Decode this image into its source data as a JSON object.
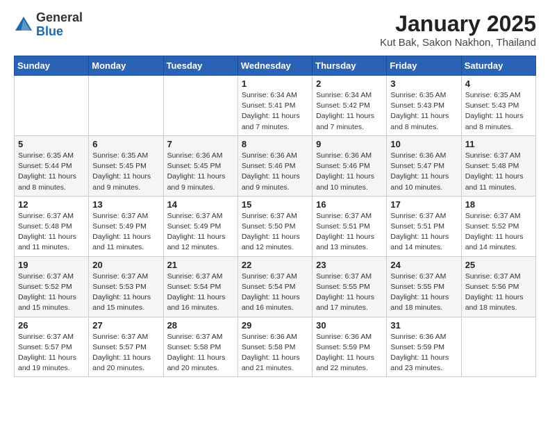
{
  "header": {
    "logo_general": "General",
    "logo_blue": "Blue",
    "month_title": "January 2025",
    "location": "Kut Bak, Sakon Nakhon, Thailand"
  },
  "weekdays": [
    "Sunday",
    "Monday",
    "Tuesday",
    "Wednesday",
    "Thursday",
    "Friday",
    "Saturday"
  ],
  "weeks": [
    [
      {
        "day": "",
        "info": ""
      },
      {
        "day": "",
        "info": ""
      },
      {
        "day": "",
        "info": ""
      },
      {
        "day": "1",
        "info": "Sunrise: 6:34 AM\nSunset: 5:41 PM\nDaylight: 11 hours\nand 7 minutes."
      },
      {
        "day": "2",
        "info": "Sunrise: 6:34 AM\nSunset: 5:42 PM\nDaylight: 11 hours\nand 7 minutes."
      },
      {
        "day": "3",
        "info": "Sunrise: 6:35 AM\nSunset: 5:43 PM\nDaylight: 11 hours\nand 8 minutes."
      },
      {
        "day": "4",
        "info": "Sunrise: 6:35 AM\nSunset: 5:43 PM\nDaylight: 11 hours\nand 8 minutes."
      }
    ],
    [
      {
        "day": "5",
        "info": "Sunrise: 6:35 AM\nSunset: 5:44 PM\nDaylight: 11 hours\nand 8 minutes."
      },
      {
        "day": "6",
        "info": "Sunrise: 6:35 AM\nSunset: 5:45 PM\nDaylight: 11 hours\nand 9 minutes."
      },
      {
        "day": "7",
        "info": "Sunrise: 6:36 AM\nSunset: 5:45 PM\nDaylight: 11 hours\nand 9 minutes."
      },
      {
        "day": "8",
        "info": "Sunrise: 6:36 AM\nSunset: 5:46 PM\nDaylight: 11 hours\nand 9 minutes."
      },
      {
        "day": "9",
        "info": "Sunrise: 6:36 AM\nSunset: 5:46 PM\nDaylight: 11 hours\nand 10 minutes."
      },
      {
        "day": "10",
        "info": "Sunrise: 6:36 AM\nSunset: 5:47 PM\nDaylight: 11 hours\nand 10 minutes."
      },
      {
        "day": "11",
        "info": "Sunrise: 6:37 AM\nSunset: 5:48 PM\nDaylight: 11 hours\nand 11 minutes."
      }
    ],
    [
      {
        "day": "12",
        "info": "Sunrise: 6:37 AM\nSunset: 5:48 PM\nDaylight: 11 hours\nand 11 minutes."
      },
      {
        "day": "13",
        "info": "Sunrise: 6:37 AM\nSunset: 5:49 PM\nDaylight: 11 hours\nand 11 minutes."
      },
      {
        "day": "14",
        "info": "Sunrise: 6:37 AM\nSunset: 5:49 PM\nDaylight: 11 hours\nand 12 minutes."
      },
      {
        "day": "15",
        "info": "Sunrise: 6:37 AM\nSunset: 5:50 PM\nDaylight: 11 hours\nand 12 minutes."
      },
      {
        "day": "16",
        "info": "Sunrise: 6:37 AM\nSunset: 5:51 PM\nDaylight: 11 hours\nand 13 minutes."
      },
      {
        "day": "17",
        "info": "Sunrise: 6:37 AM\nSunset: 5:51 PM\nDaylight: 11 hours\nand 14 minutes."
      },
      {
        "day": "18",
        "info": "Sunrise: 6:37 AM\nSunset: 5:52 PM\nDaylight: 11 hours\nand 14 minutes."
      }
    ],
    [
      {
        "day": "19",
        "info": "Sunrise: 6:37 AM\nSunset: 5:52 PM\nDaylight: 11 hours\nand 15 minutes."
      },
      {
        "day": "20",
        "info": "Sunrise: 6:37 AM\nSunset: 5:53 PM\nDaylight: 11 hours\nand 15 minutes."
      },
      {
        "day": "21",
        "info": "Sunrise: 6:37 AM\nSunset: 5:54 PM\nDaylight: 11 hours\nand 16 minutes."
      },
      {
        "day": "22",
        "info": "Sunrise: 6:37 AM\nSunset: 5:54 PM\nDaylight: 11 hours\nand 16 minutes."
      },
      {
        "day": "23",
        "info": "Sunrise: 6:37 AM\nSunset: 5:55 PM\nDaylight: 11 hours\nand 17 minutes."
      },
      {
        "day": "24",
        "info": "Sunrise: 6:37 AM\nSunset: 5:55 PM\nDaylight: 11 hours\nand 18 minutes."
      },
      {
        "day": "25",
        "info": "Sunrise: 6:37 AM\nSunset: 5:56 PM\nDaylight: 11 hours\nand 18 minutes."
      }
    ],
    [
      {
        "day": "26",
        "info": "Sunrise: 6:37 AM\nSunset: 5:57 PM\nDaylight: 11 hours\nand 19 minutes."
      },
      {
        "day": "27",
        "info": "Sunrise: 6:37 AM\nSunset: 5:57 PM\nDaylight: 11 hours\nand 20 minutes."
      },
      {
        "day": "28",
        "info": "Sunrise: 6:37 AM\nSunset: 5:58 PM\nDaylight: 11 hours\nand 20 minutes."
      },
      {
        "day": "29",
        "info": "Sunrise: 6:36 AM\nSunset: 5:58 PM\nDaylight: 11 hours\nand 21 minutes."
      },
      {
        "day": "30",
        "info": "Sunrise: 6:36 AM\nSunset: 5:59 PM\nDaylight: 11 hours\nand 22 minutes."
      },
      {
        "day": "31",
        "info": "Sunrise: 6:36 AM\nSunset: 5:59 PM\nDaylight: 11 hours\nand 23 minutes."
      },
      {
        "day": "",
        "info": ""
      }
    ]
  ]
}
